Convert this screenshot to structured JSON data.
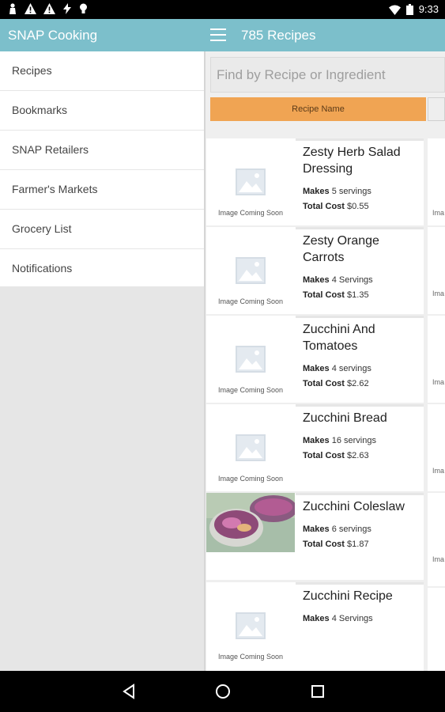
{
  "status": {
    "time": "9:33",
    "left_icons": [
      "person-icon",
      "warning-icon",
      "warning-icon",
      "flash-icon",
      "tip-icon"
    ],
    "right_icons": [
      "wifi-icon",
      "battery-icon"
    ]
  },
  "appbar": {
    "app_name": "SNAP Cooking",
    "count_title": "785 Recipes",
    "color": "#7cbfcb"
  },
  "drawer": {
    "items": [
      {
        "label": "Recipes"
      },
      {
        "label": "Bookmarks"
      },
      {
        "label": "SNAP Retailers"
      },
      {
        "label": "Farmer's Markets"
      },
      {
        "label": "Grocery List"
      },
      {
        "label": "Notifications"
      }
    ]
  },
  "search": {
    "placeholder": "Find by Recipe or Ingredient",
    "value": ""
  },
  "sort_header": {
    "label": "Recipe Name",
    "color": "#f0a453"
  },
  "placeholder_text": "Image Coming Soon",
  "recipes": [
    {
      "name": "Zesty Herb Salad Dressing",
      "makes_label": "Makes",
      "makes": "5 servings",
      "cost_label": "Total Cost",
      "cost": "$0.55",
      "image": "placeholder"
    },
    {
      "name": "Zesty Orange Carrots",
      "makes_label": "Makes",
      "makes": "4 Servings",
      "cost_label": "Total Cost",
      "cost": "$1.35",
      "image": "placeholder"
    },
    {
      "name": "Zucchini And Tomatoes",
      "makes_label": "Makes",
      "makes": "4 servings",
      "cost_label": "Total Cost",
      "cost": "$2.62",
      "image": "placeholder"
    },
    {
      "name": "Zucchini Bread",
      "makes_label": "Makes",
      "makes": "16 servings",
      "cost_label": "Total Cost",
      "cost": "$2.63",
      "image": "placeholder"
    },
    {
      "name": "Zucchini Coleslaw",
      "makes_label": "Makes",
      "makes": "6 servings",
      "cost_label": "Total Cost",
      "cost": "$1.87",
      "image": "photo"
    },
    {
      "name": "Zucchini Recipe",
      "makes_label": "Makes",
      "makes": "4 Servings",
      "image": "placeholder"
    }
  ],
  "strip_text": "Ima",
  "nav": {
    "icons": [
      "back-icon",
      "home-icon",
      "recents-icon"
    ]
  }
}
